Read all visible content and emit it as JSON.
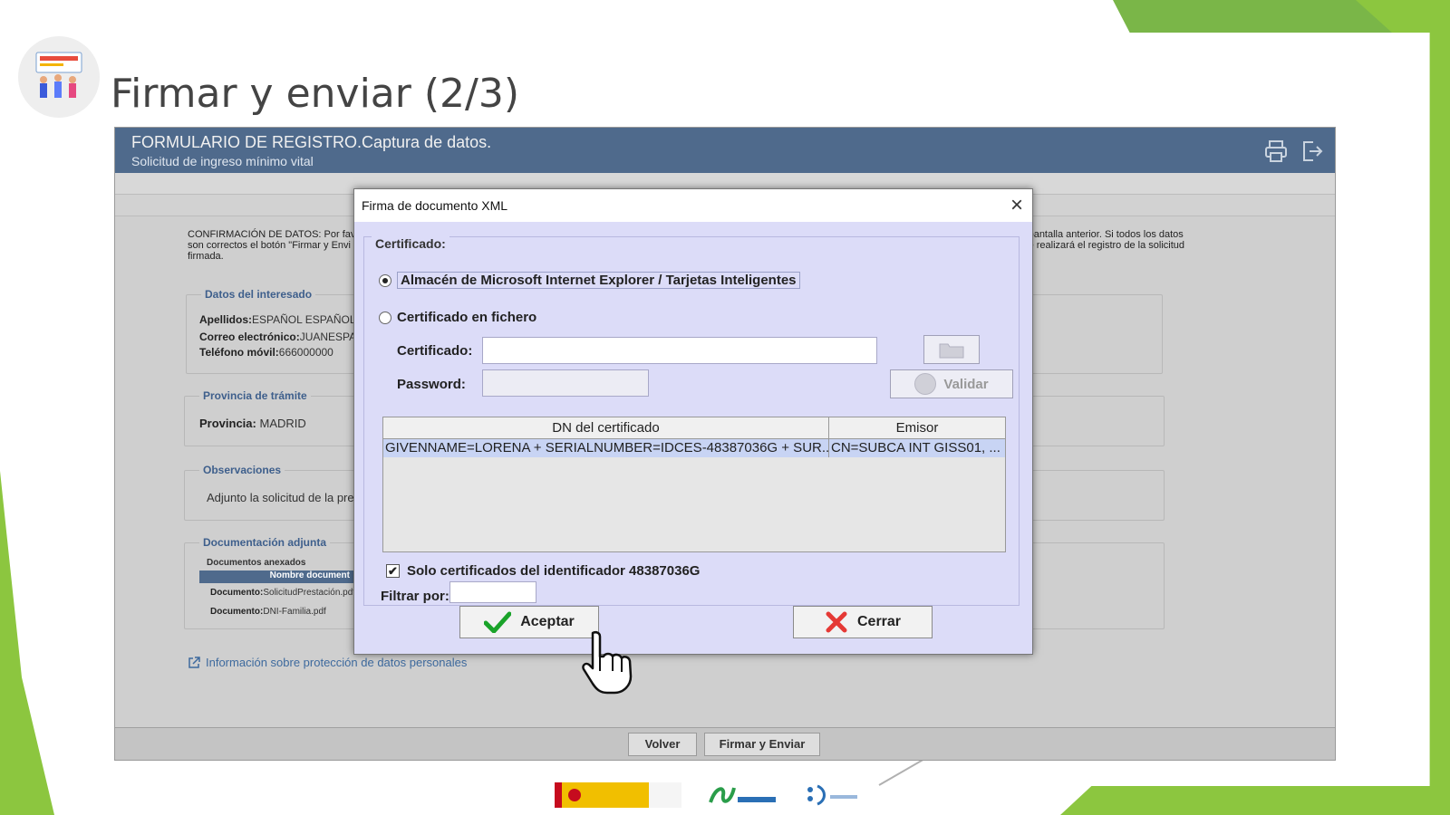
{
  "slide": {
    "title": "Firmar y enviar (2/3)"
  },
  "app": {
    "header_title": "FORMULARIO DE REGISTRO.Captura de datos.",
    "header_subtitle": "Solicitud de ingreso mínimo vital",
    "icons": [
      "printer-icon",
      "logout-icon"
    ],
    "confirmation_left": "CONFIRMACIÓN DE DATOS: Por favo",
    "confirmation_left_2": "son correctos el botón \"Firmar y Envi",
    "confirmation_left_3": "firmada.",
    "confirmation_right": "pantalla anterior. Si todos los datos",
    "confirmation_right_2": "e realizará el registro de la solicitud",
    "interesado": {
      "legend": "Datos del interesado",
      "apellidos_label": "Apellidos:",
      "apellidos_value": "ESPAÑOL ESPAÑOL",
      "correo_label": "Correo electrónico:",
      "correo_value": "JUANESPAÑ",
      "telefono_label": "Teléfono móvil:",
      "telefono_value": "666000000"
    },
    "provincia": {
      "legend": "Provincia de trámite",
      "label": "Provincia:",
      "value": "MADRID"
    },
    "observaciones": {
      "legend": "Observaciones",
      "value": "Adjunto la solicitud de la pres"
    },
    "documentacion": {
      "legend": "Documentación adjunta",
      "subheader": "Documentos anexados",
      "column": "Nombre document",
      "rows": [
        {
          "label": "Documento:",
          "value": "SolicitudPrestación.pdf"
        },
        {
          "label": "Documento:",
          "value": "DNI-Familia.pdf"
        }
      ]
    },
    "info_link": "Información sobre protección de datos personales",
    "btn_volver": "Volver",
    "btn_firmar": "Firmar y Enviar"
  },
  "dialog": {
    "title": "Firma de documento XML",
    "close_label": "×",
    "group_label": "Certificado:",
    "option_store": "Almacén de Microsoft Internet Explorer / Tarjetas Inteligentes",
    "option_file": "Certificado en fichero",
    "cert_label": "Certificado:",
    "cert_value": "",
    "password_label": "Password:",
    "validar_label": "Validar",
    "table": {
      "headers": [
        "DN del certificado",
        "Emisor"
      ],
      "rows": [
        [
          "GIVENNAME=LORENA + SERIALNUMBER=IDCES-48387036G + SUR...",
          "CN=SUBCA INT GISS01, ..."
        ]
      ]
    },
    "checkbox_label": "Solo certificados del identificador 48387036G",
    "filter_label": "Filtrar por:",
    "filter_value": "",
    "btn_accept": "Aceptar",
    "btn_close": "Cerrar"
  },
  "colors": {
    "header_bg": "#4f6a8c",
    "dialog_bg": "#dcdcf8",
    "accent_green": "#8cc63f",
    "selection_row": "#c8d4f4"
  }
}
